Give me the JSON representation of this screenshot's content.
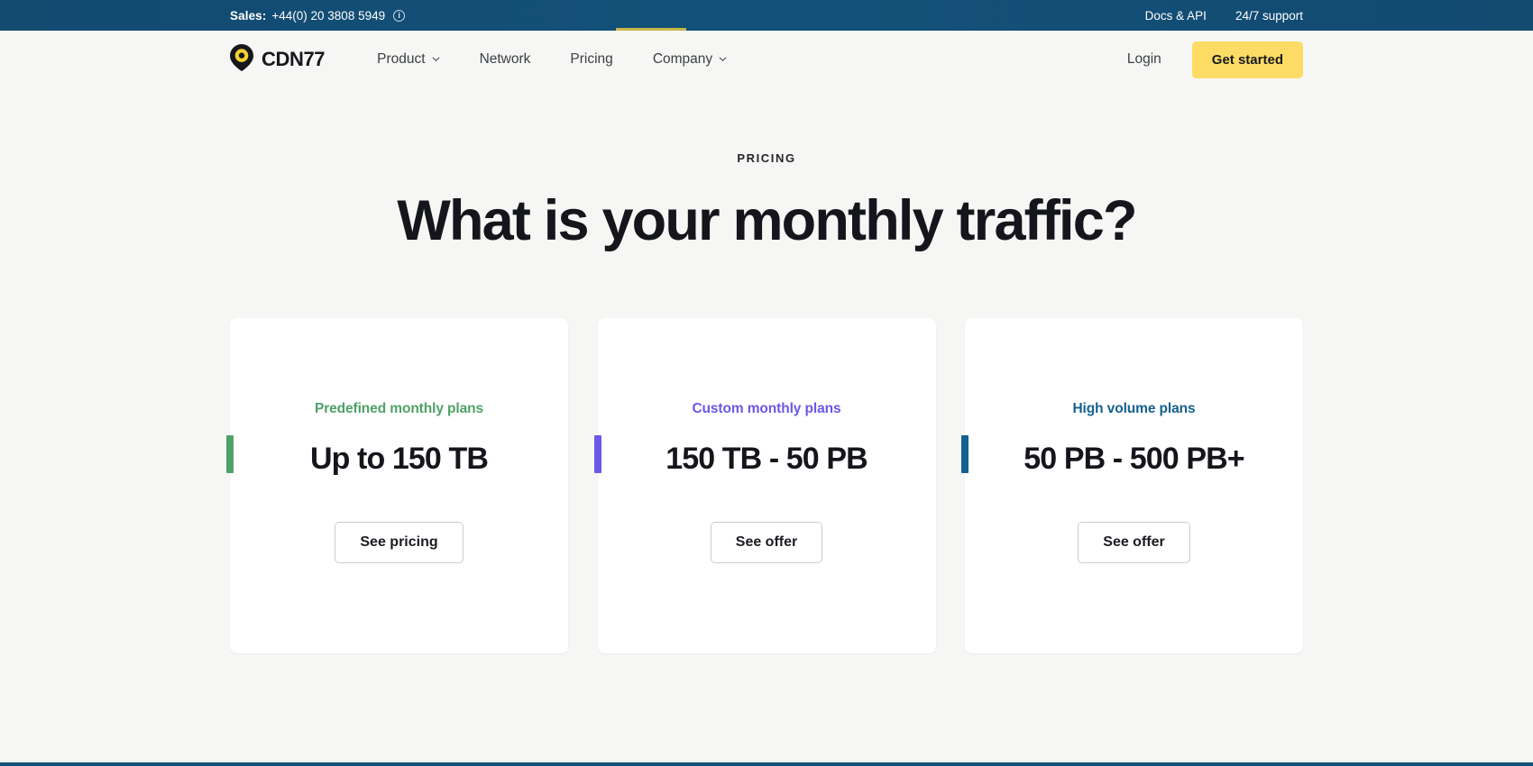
{
  "topbar": {
    "sales_label": "Sales:",
    "sales_number": "+44(0) 20 3808 5949",
    "info_icon": "info-circle-icon",
    "docs_link": "Docs & API",
    "support_link": "24/7 support"
  },
  "nav": {
    "brand": "CDN77",
    "logo_icon": "map-pin-logo-icon",
    "links": [
      {
        "label": "Product",
        "has_chevron": true
      },
      {
        "label": "Network",
        "has_chevron": false
      },
      {
        "label": "Pricing",
        "has_chevron": false
      },
      {
        "label": "Company",
        "has_chevron": true
      }
    ],
    "login": "Login",
    "cta": "Get started"
  },
  "hero": {
    "eyebrow": "PRICING",
    "title": "What is your monthly traffic?"
  },
  "cards": [
    {
      "label": "Predefined monthly plans",
      "title": "Up to 150 TB",
      "button": "See pricing",
      "accent": "#4ea167"
    },
    {
      "label": "Custom monthly plans",
      "title": "150 TB - 50 PB",
      "button": "See offer",
      "accent": "#6a58e8"
    },
    {
      "label": "High volume plans",
      "title": "50 PB - 500 PB+",
      "button": "See offer",
      "accent": "#15608f"
    }
  ],
  "colors": {
    "topbar_bg": "#124a70",
    "cta_yellow": "#fcdc64",
    "page_bg": "#f6f6f4",
    "card_bg": "#ffffff",
    "bottom_strip": "#12537c",
    "topbar_accent": "#e9c93f"
  }
}
